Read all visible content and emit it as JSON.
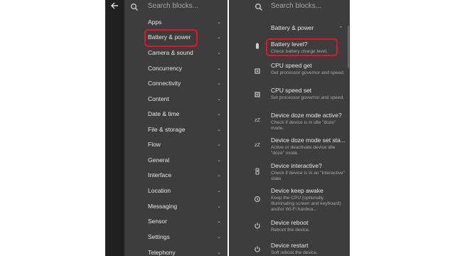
{
  "search": {
    "placeholder": "Search blocks..."
  },
  "icons": {
    "back": "arrow-left-icon",
    "search": "search-icon",
    "chevron_down": "chevron-down-icon",
    "chevron_up": "chevron-up-icon"
  },
  "colors": {
    "panel_bg": "#3d3d3d",
    "highlight": "#e0172b",
    "text": "#e6e6e6",
    "muted": "#a8a8a8"
  },
  "left": {
    "categories": [
      {
        "label": "Apps"
      },
      {
        "label": "Battery & power"
      },
      {
        "label": "Camera & sound"
      },
      {
        "label": "Concurrency"
      },
      {
        "label": "Connectivity"
      },
      {
        "label": "Content"
      },
      {
        "label": "Date & time"
      },
      {
        "label": "File & storage"
      },
      {
        "label": "Flow"
      },
      {
        "label": "General"
      },
      {
        "label": "Interface"
      },
      {
        "label": "Location"
      },
      {
        "label": "Messaging"
      },
      {
        "label": "Sensor"
      },
      {
        "label": "Settings"
      },
      {
        "label": "Telephony"
      }
    ]
  },
  "right": {
    "category": "Battery & power",
    "blocks": [
      {
        "icon": "battery-icon",
        "title": "Battery level?",
        "desc": "Check battery charge level."
      },
      {
        "icon": "cpu-icon",
        "title": "CPU speed get",
        "desc": "Get processor governor and speed."
      },
      {
        "icon": "cpu-set-icon",
        "title": "CPU speed set",
        "desc": "Set processor governor and speed."
      },
      {
        "icon": "doze-icon",
        "title": "Device doze mode active?",
        "desc": "Check if device is in idle \"doze\" mode."
      },
      {
        "icon": "doze-set-icon",
        "title": "Device doze mode set sta...",
        "desc": "Active or deactivate device idle \"doze\" mode."
      },
      {
        "icon": "phone-icon",
        "title": "Device interactive?",
        "desc": "Check if device is in an \"interactive\" state."
      },
      {
        "icon": "keep-awake-icon",
        "title": "Device keep awake",
        "desc": "Keep the CPU (optionally illuminating screen and keyboard) and/or Wi-Fi hardwa..."
      },
      {
        "icon": "power-icon",
        "title": "Device reboot",
        "desc": "Reboot the device."
      },
      {
        "icon": "power-icon",
        "title": "Device restart",
        "desc": "Soft reboot the device."
      }
    ]
  }
}
